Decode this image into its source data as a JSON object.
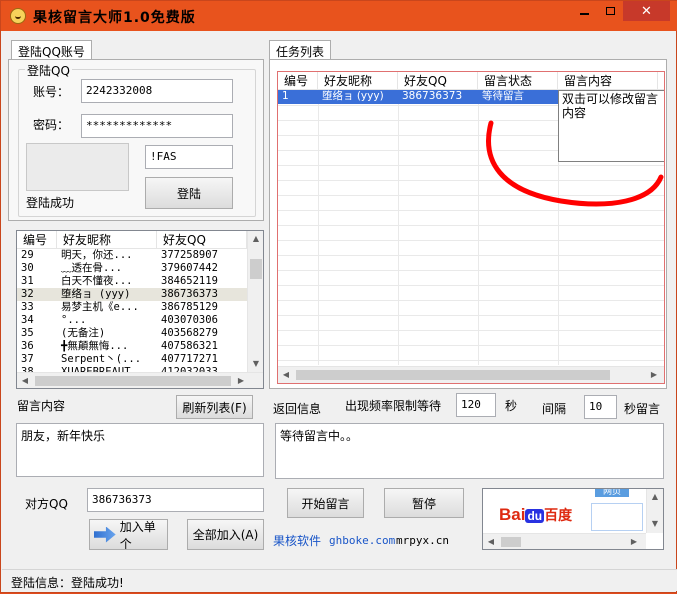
{
  "window": {
    "title": "果核留言大师1.0免费版",
    "close_glyph": "✕"
  },
  "login": {
    "tab_label": "登陆QQ账号",
    "group_label": "登陆QQ",
    "account_label": "账号：",
    "account_value": "2242332008",
    "password_label": "密码：",
    "password_value": "*************",
    "code_value": "!FAS",
    "login_button": "登陆",
    "status_text": "登陆成功"
  },
  "friends": {
    "columns": [
      "编号",
      "好友昵称",
      "好友QQ"
    ],
    "rows": [
      [
        "29",
        "明天，你还...",
        "377258907"
      ],
      [
        "30",
        "﹏透在骨...",
        "379607442"
      ],
      [
        "31",
        "白天不懂夜...",
        "384652119"
      ],
      [
        "32",
        "堕络ョ (yyy)",
        "386736373"
      ],
      [
        "33",
        "易梦主机《e...",
        "386785129"
      ],
      [
        "34",
        "°...",
        "403070306"
      ],
      [
        "35",
        "(无备注)",
        "403568279"
      ],
      [
        "36",
        "╋無顛無悔...",
        "407586321"
      ],
      [
        "37",
        "Serpent丶(...",
        "407717271"
      ],
      [
        "38",
        "XUAREBREAUT",
        "412032033"
      ]
    ],
    "selected_index": 3
  },
  "tasks": {
    "tab_label": "任务列表",
    "columns": [
      "编号",
      "好友昵称",
      "好友QQ",
      "留言状态",
      "留言内容"
    ],
    "rows": [
      [
        "1",
        "堕络ョ (yyy)",
        "386736373",
        "等待留言",
        "双击可以修改留言内容"
      ]
    ],
    "tooltip": "双击可以修改留言内容"
  },
  "message": {
    "label": "留言内容",
    "refresh_button": "刷新列表(F)",
    "content": "朋友，新年快乐",
    "target_label": "对方QQ",
    "target_value": "386736373",
    "add_single_button": "加入单个",
    "add_all_button": "全部加入(A)"
  },
  "control": {
    "return_label": "返回信息",
    "freq_label": "出现频率限制等待",
    "freq_value": "120",
    "sec_label": "秒",
    "interval_label": "间隔",
    "interval_value": "10",
    "sec_message_label": "秒留言",
    "return_content": "等待留言中。。",
    "start_button": "开始留言",
    "pause_button": "暂停",
    "links": [
      "果核软件",
      "ghboke.com",
      "mrpyx.cn"
    ]
  },
  "ad": {
    "logo_text": "Bai",
    "logo_paw": "du",
    "logo_cn": "百度",
    "tab_label": "网页"
  },
  "statusbar": {
    "text": "登陆信息：登陆成功!"
  },
  "colors": {
    "titlebar": "#e8531d",
    "selection": "#3a6fd8",
    "annotation": "#ff0000"
  }
}
